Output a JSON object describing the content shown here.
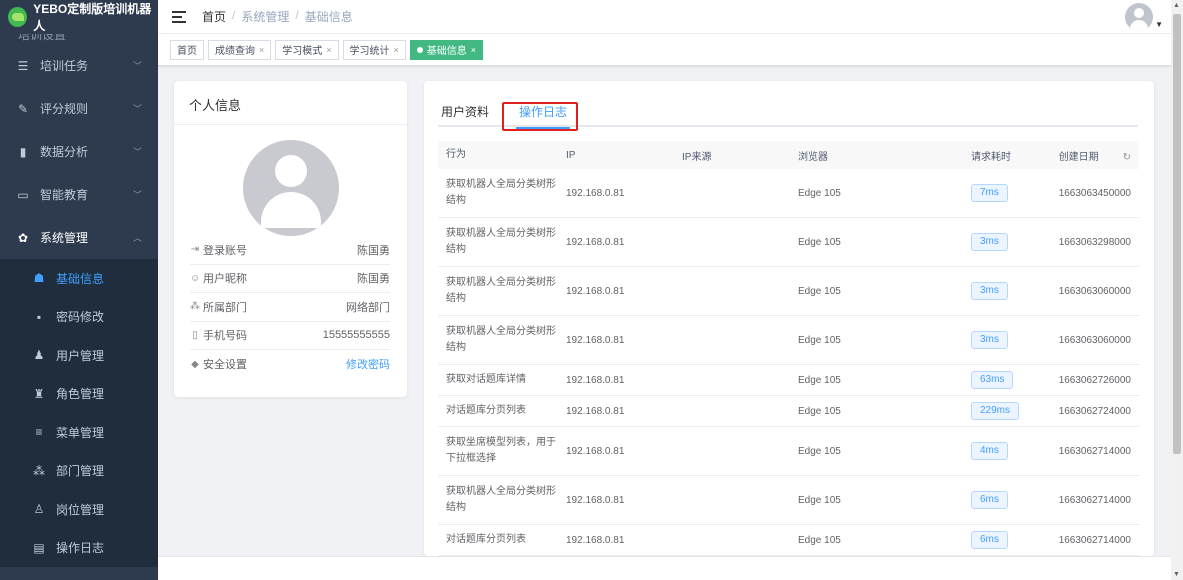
{
  "app": {
    "title": "YEBO定制版培训机器人"
  },
  "sidebar": {
    "hidden_item": "培训设置",
    "items": [
      {
        "icon": "list-icon",
        "label": "培训任务"
      },
      {
        "icon": "edit-icon",
        "label": "评分规则"
      },
      {
        "icon": "bar-chart-icon",
        "label": "数据分析"
      },
      {
        "icon": "monitor-icon",
        "label": "智能教育"
      },
      {
        "icon": "gear-icon",
        "label": "系统管理"
      }
    ],
    "sub_items": [
      {
        "icon": "user-card-icon",
        "label": "基础信息"
      },
      {
        "icon": "lock-icon",
        "label": "密码修改"
      },
      {
        "icon": "users-icon",
        "label": "用户管理"
      },
      {
        "icon": "role-icon",
        "label": "角色管理"
      },
      {
        "icon": "menu-icon",
        "label": "菜单管理"
      },
      {
        "icon": "org-tree-icon",
        "label": "部门管理"
      },
      {
        "icon": "post-icon",
        "label": "岗位管理"
      },
      {
        "icon": "log-icon",
        "label": "操作日志"
      }
    ]
  },
  "breadcrumb": {
    "home": "首页",
    "sep": "/",
    "level1": "系统管理",
    "level2": "基础信息"
  },
  "tags": [
    {
      "label": "首页"
    },
    {
      "label": "成绩查询"
    },
    {
      "label": "学习模式"
    },
    {
      "label": "学习统计"
    },
    {
      "label": "基础信息"
    }
  ],
  "profile": {
    "title": "个人信息",
    "rows": [
      {
        "icon": "login-icon",
        "label": "登录账号",
        "value": "陈国勇"
      },
      {
        "icon": "smile-icon",
        "label": "用户昵称",
        "value": "陈国勇"
      },
      {
        "icon": "org-icon",
        "label": "所属部门",
        "value": "网络部门"
      },
      {
        "icon": "phone-icon",
        "label": "手机号码",
        "value": "15555555555"
      },
      {
        "icon": "shield-icon",
        "label": "安全设置",
        "value": "修改密码"
      }
    ]
  },
  "tabs": {
    "profile": "用户资料",
    "log": "操作日志"
  },
  "table": {
    "headers": {
      "action": "行为",
      "ip": "IP",
      "ip_source": "IP来源",
      "browser": "浏览器",
      "time": "请求耗时",
      "created": "创建日期"
    },
    "rows": [
      {
        "action": "获取机器人全局分类树形结构",
        "ip": "192.168.0.81",
        "ip_source": "",
        "browser": "Edge 105",
        "time": "7ms",
        "created": "1663063450000"
      },
      {
        "action": "获取机器人全局分类树形结构",
        "ip": "192.168.0.81",
        "ip_source": "",
        "browser": "Edge 105",
        "time": "3ms",
        "created": "1663063298000"
      },
      {
        "action": "获取机器人全局分类树形结构",
        "ip": "192.168.0.81",
        "ip_source": "",
        "browser": "Edge 105",
        "time": "3ms",
        "created": "1663063060000"
      },
      {
        "action": "获取机器人全局分类树形结构",
        "ip": "192.168.0.81",
        "ip_source": "",
        "browser": "Edge 105",
        "time": "3ms",
        "created": "1663063060000"
      },
      {
        "action": "获取对话题库详情",
        "ip": "192.168.0.81",
        "ip_source": "",
        "browser": "Edge 105",
        "time": "63ms",
        "created": "1663062726000"
      },
      {
        "action": "对话题库分页列表",
        "ip": "192.168.0.81",
        "ip_source": "",
        "browser": "Edge 105",
        "time": "229ms",
        "created": "1663062724000"
      },
      {
        "action": "获取坐席模型列表，用于下拉框选择",
        "ip": "192.168.0.81",
        "ip_source": "",
        "browser": "Edge 105",
        "time": "4ms",
        "created": "1663062714000"
      },
      {
        "action": "获取机器人全局分类树形结构",
        "ip": "192.168.0.81",
        "ip_source": "",
        "browser": "Edge 105",
        "time": "6ms",
        "created": "1663062714000"
      },
      {
        "action": "对话题库分页列表",
        "ip": "192.168.0.81",
        "ip_source": "",
        "browser": "Edge 105",
        "time": "6ms",
        "created": "1663062714000"
      }
    ]
  },
  "colors": {
    "sidebar": "#2e3b4e",
    "submenu": "#1f2d3d",
    "accent": "#409eff",
    "tag_active": "#42b983",
    "highlight": "#e02020"
  }
}
